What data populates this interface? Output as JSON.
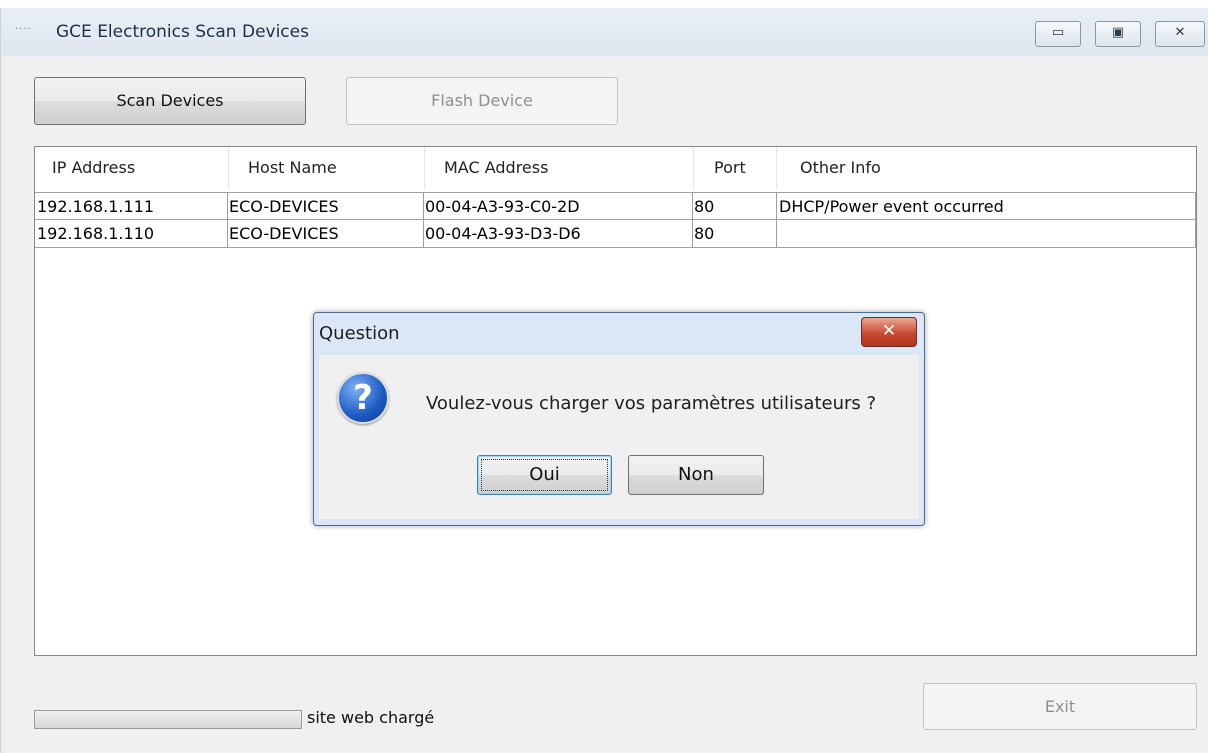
{
  "window": {
    "title": "GCE Electronics Scan Devices",
    "controls": {
      "minimize_icon": "minimize-icon",
      "maximize_icon": "maximize-icon",
      "close_icon": "close-icon"
    }
  },
  "toolbar": {
    "scan_label": "Scan Devices",
    "flash_label": "Flash Device"
  },
  "table": {
    "columns": [
      "IP Address",
      "Host Name",
      "MAC Address",
      "Port",
      "Other Info"
    ],
    "rows": [
      [
        "192.168.1.111",
        "ECO-DEVICES",
        "00-04-A3-93-C0-2D",
        "80",
        "DHCP/Power event occurred"
      ],
      [
        "192.168.1.110",
        "ECO-DEVICES",
        "00-04-A3-93-D3-D6",
        "80",
        ""
      ]
    ]
  },
  "status": {
    "text": "site web chargé"
  },
  "exit_label": "Exit",
  "dialog": {
    "title": "Question",
    "icon": "question-icon",
    "message": "Voulez-vous charger vos paramètres utilisateurs ?",
    "yes_label": "Oui",
    "no_label": "Non"
  },
  "colors": {
    "titlebar": "#dfe7f1",
    "dialog_frame": "#dbe7f6",
    "close_button": "#c94a32"
  }
}
